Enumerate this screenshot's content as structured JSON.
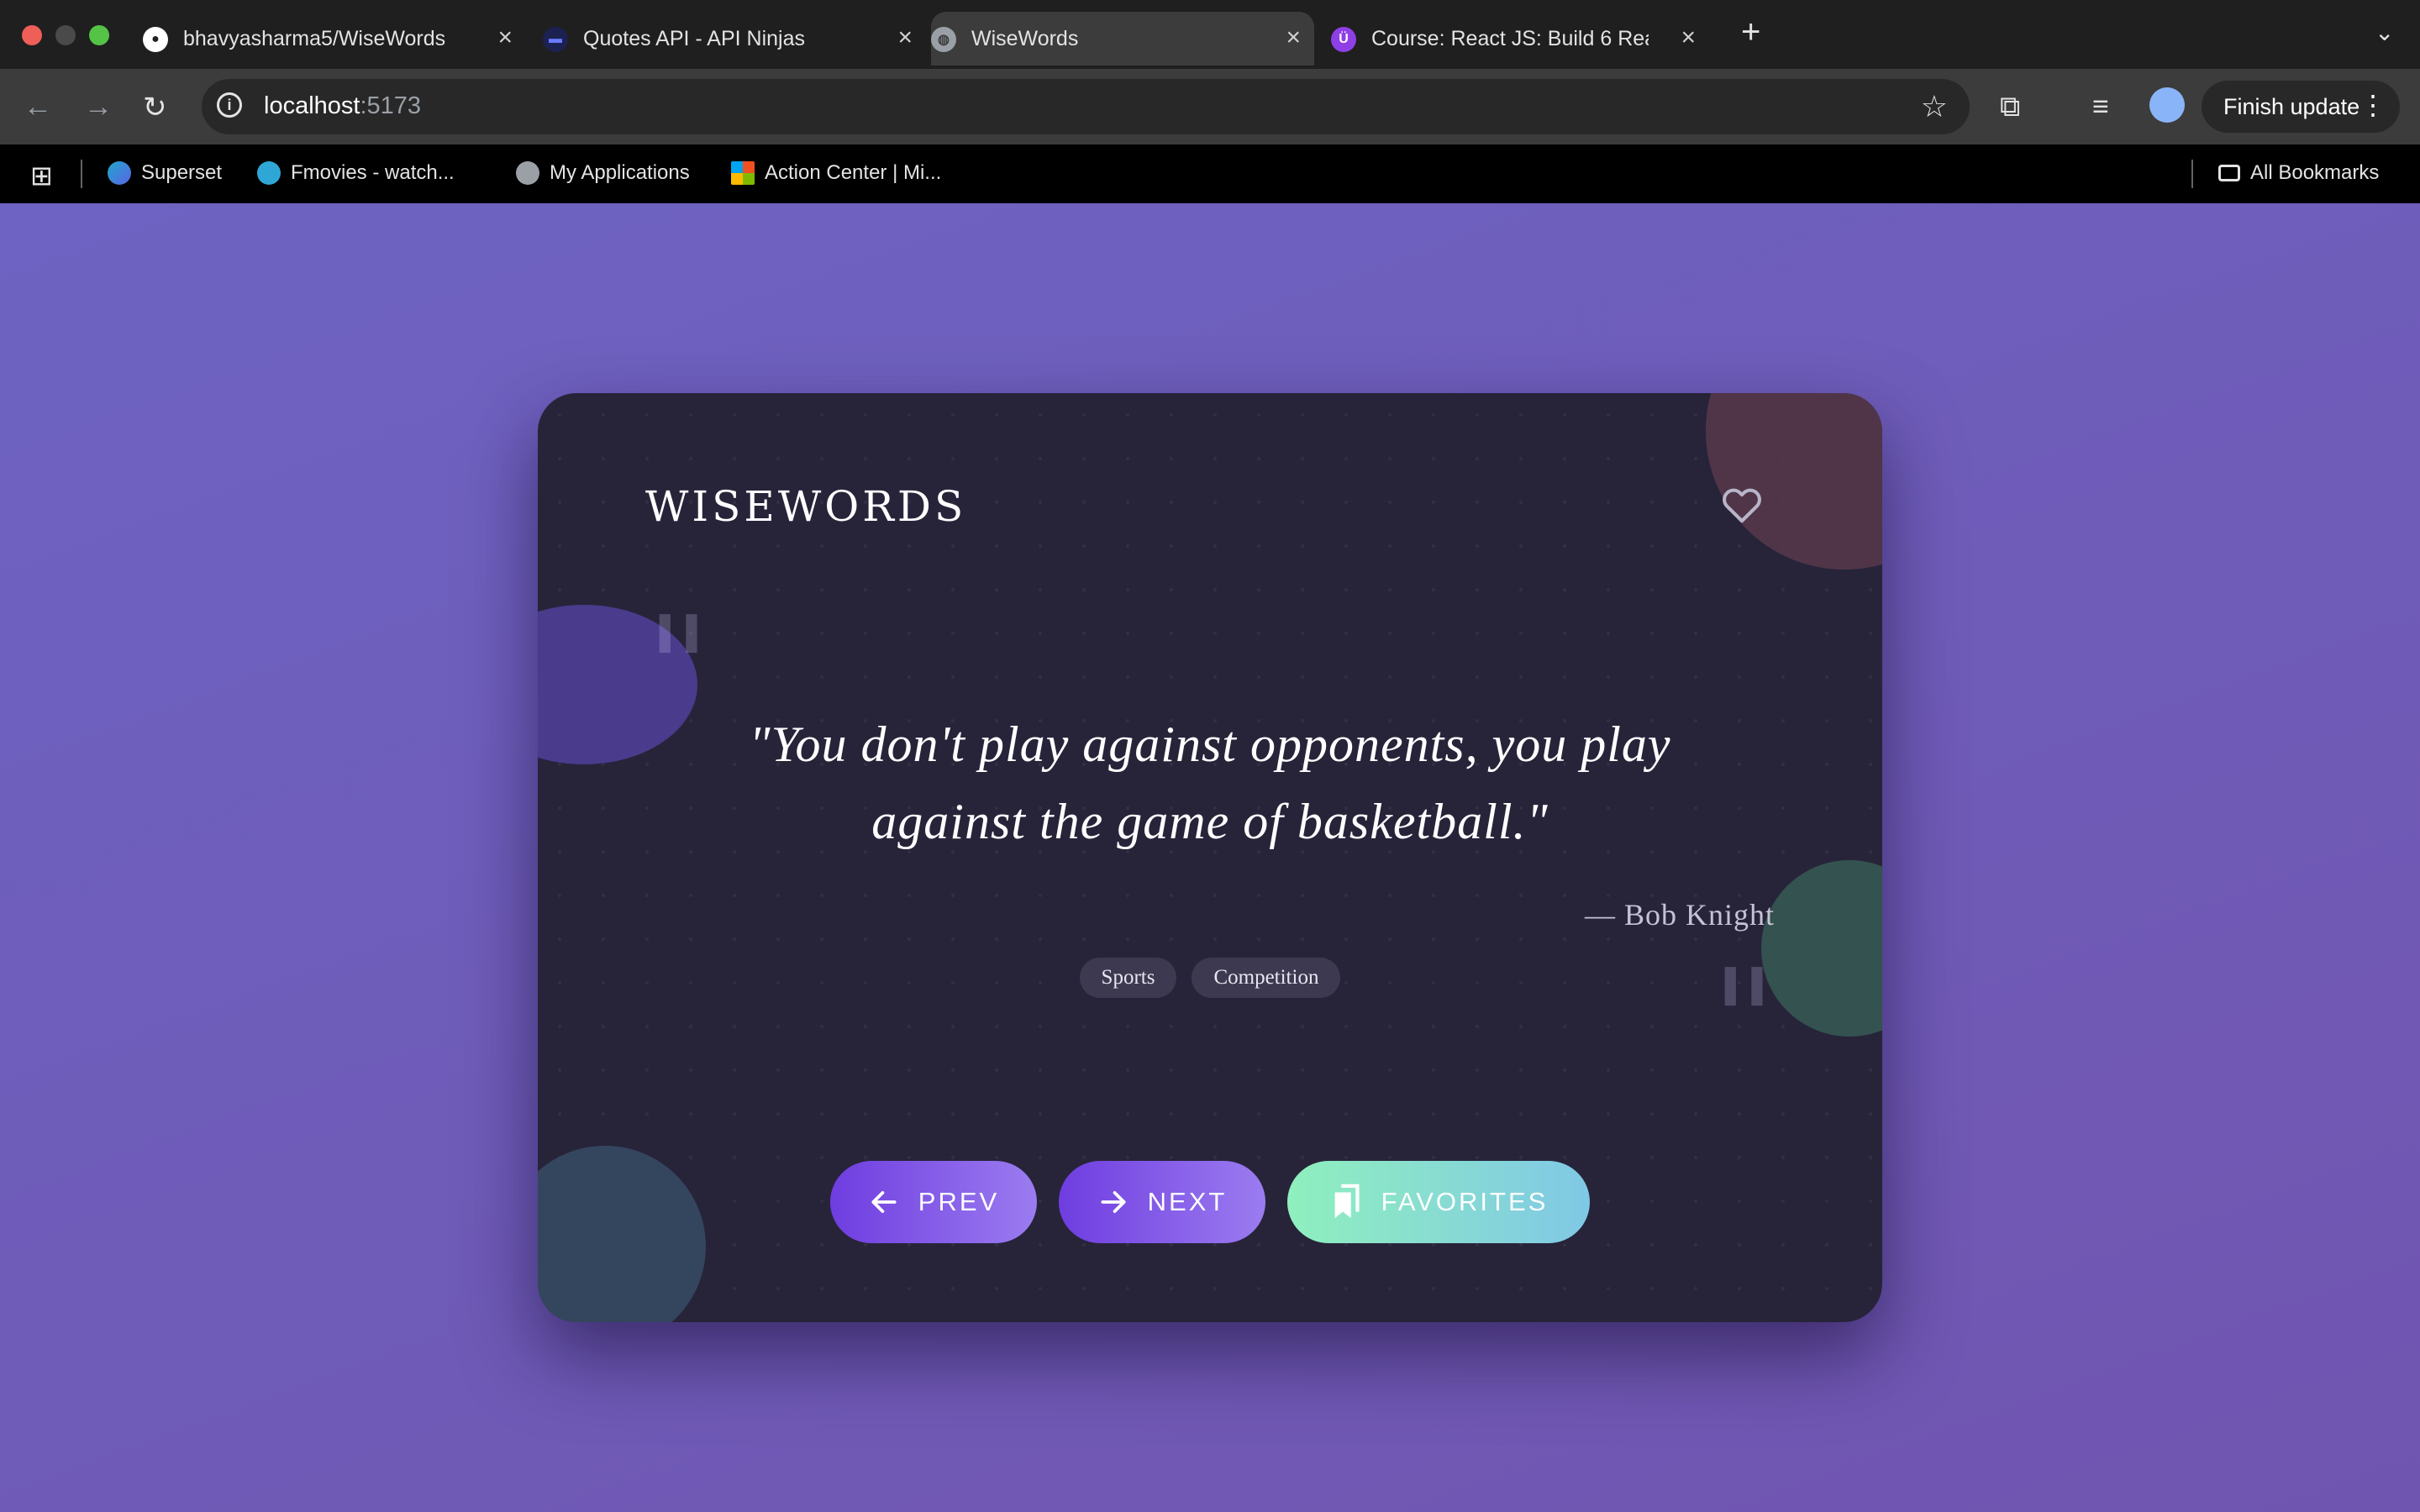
{
  "browser": {
    "tabs": [
      {
        "label": "bhavyasharma5/WiseWords",
        "icon": "github-icon",
        "active": false
      },
      {
        "label": "Quotes API - API Ninjas",
        "icon": "api-ninjas-icon",
        "active": false
      },
      {
        "label": "WiseWords",
        "icon": "globe-icon",
        "active": true
      },
      {
        "label": "Course: React JS: Build 6 Rea",
        "icon": "udemy-icon",
        "active": false
      }
    ],
    "url_host": "localhost",
    "url_port": ":5173",
    "finish_update_label": "Finish update",
    "bookmarks": [
      {
        "label": "Superset",
        "icon": "superset-icon"
      },
      {
        "label": "Fmovies - watch...",
        "icon": "fmovies-icon"
      },
      {
        "label": "My Applications",
        "icon": "globe-icon"
      },
      {
        "label": "Action Center | Mi...",
        "icon": "microsoft-icon"
      }
    ],
    "all_bookmarks_label": "All Bookmarks"
  },
  "app": {
    "brand": "WISEWORDS",
    "quote": "\"You don't play against opponents, you play against the game of basketball.\"",
    "author": "— Bob Knight",
    "tags": [
      "Sports",
      "Competition"
    ],
    "buttons": {
      "prev": "PREV",
      "next": "NEXT",
      "favorites": "FAVORITES"
    }
  },
  "colors": {
    "background": "#6f5fb8",
    "card": "#27243a",
    "primary_button": "#7a4ee6",
    "favorites_button": "#8ff0bd"
  }
}
